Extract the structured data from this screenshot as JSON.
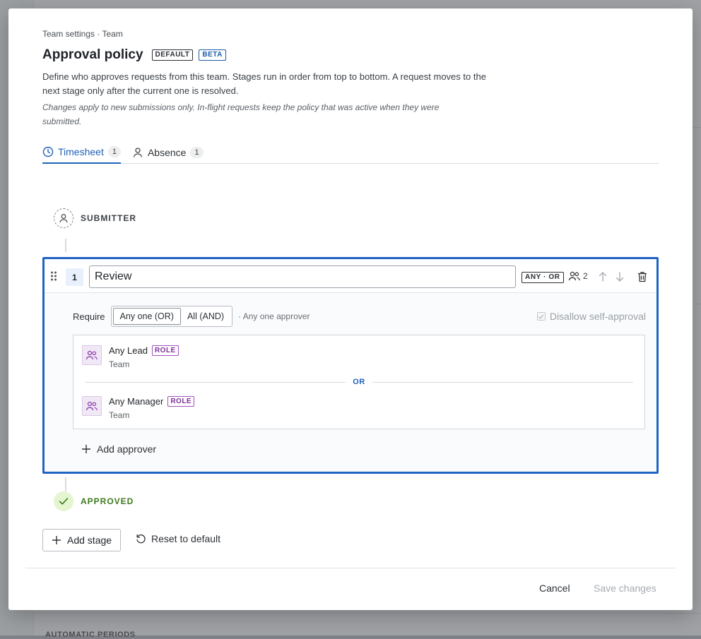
{
  "background": {
    "footer_text": "AUTOMATIC PERIODS"
  },
  "breadcrumb": "Team settings · Team",
  "title": "Approval policy",
  "badges": {
    "default": "DEFAULT",
    "beta": "BETA"
  },
  "description": "Define who approves requests from this team. Stages run in order from top to bottom. A request moves to the next stage only after the current one is resolved.",
  "note": "Changes apply to new submissions only. In-flight requests keep the policy that was active when they were submitted.",
  "tabs": [
    {
      "label": "Timesheet",
      "count": "1",
      "icon": "clock-icon",
      "active": true
    },
    {
      "label": "Absence",
      "count": "1",
      "icon": "person-icon",
      "active": false
    }
  ],
  "flow": {
    "start_label": "SUBMITTER",
    "end_label": "APPROVED"
  },
  "stage": {
    "number": "1",
    "name": "Review",
    "mode_badge": "ANY · OR",
    "approver_count": "2",
    "require_label": "Require",
    "require_options": [
      "Any one (OR)",
      "All (AND)"
    ],
    "require_selected": "Any one (OR)",
    "require_hint": "· Any one approver",
    "self_approval_label": "Disallow self-approval",
    "approvers": [
      {
        "name": "Any Lead",
        "tag": "ROLE",
        "scope": "Team"
      },
      {
        "name": "Any Manager",
        "tag": "ROLE",
        "scope": "Team"
      }
    ],
    "separator": "OR",
    "add_approver_label": "Add approver"
  },
  "actions": {
    "add_stage": "Add stage",
    "reset": "Reset to default",
    "cancel": "Cancel",
    "save": "Save changes"
  },
  "colors": {
    "accent": "#1f63c4",
    "role": "#7b2f9b",
    "approved": "#3f7a1e"
  }
}
